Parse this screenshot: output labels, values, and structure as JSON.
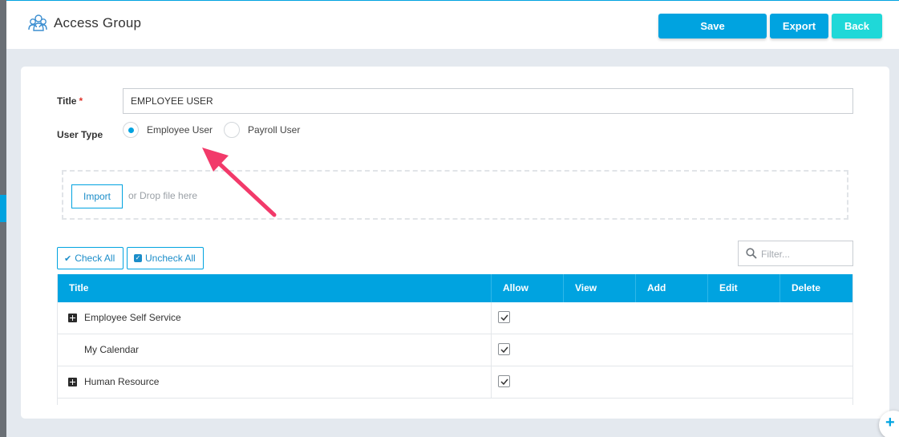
{
  "header": {
    "title": "Access Group",
    "save_label": "Save",
    "export_label": "Export",
    "back_label": "Back"
  },
  "form": {
    "title_label": "Title",
    "required_mark": "*",
    "title_value": "EMPLOYEE USER",
    "user_type_label": "User Type",
    "user_types": [
      {
        "label": "Employee User",
        "selected": true
      },
      {
        "label": "Payroll User",
        "selected": false
      }
    ]
  },
  "import": {
    "button_label": "Import",
    "drop_text": "or Drop file here"
  },
  "table_tools": {
    "check_all_label": "Check All",
    "uncheck_all_label": "Uncheck All",
    "filter_placeholder": "Filter..."
  },
  "table": {
    "headers": [
      "Title",
      "Allow",
      "View",
      "Add",
      "Edit",
      "Delete"
    ],
    "rows": [
      {
        "title": "Employee Self Service",
        "expandable": true,
        "allow": true
      },
      {
        "title": "My Calendar",
        "expandable": false,
        "allow": true
      },
      {
        "title": "Human Resource",
        "expandable": true,
        "allow": true
      }
    ]
  },
  "colors": {
    "accent": "#00a3e0",
    "back_button": "#1fd8d8",
    "annotation_arrow": "#f23a6a"
  },
  "icons": {
    "app": "users-group-icon",
    "filter": "search-icon",
    "expand": "plus-square-icon",
    "fab": "plus-icon"
  }
}
